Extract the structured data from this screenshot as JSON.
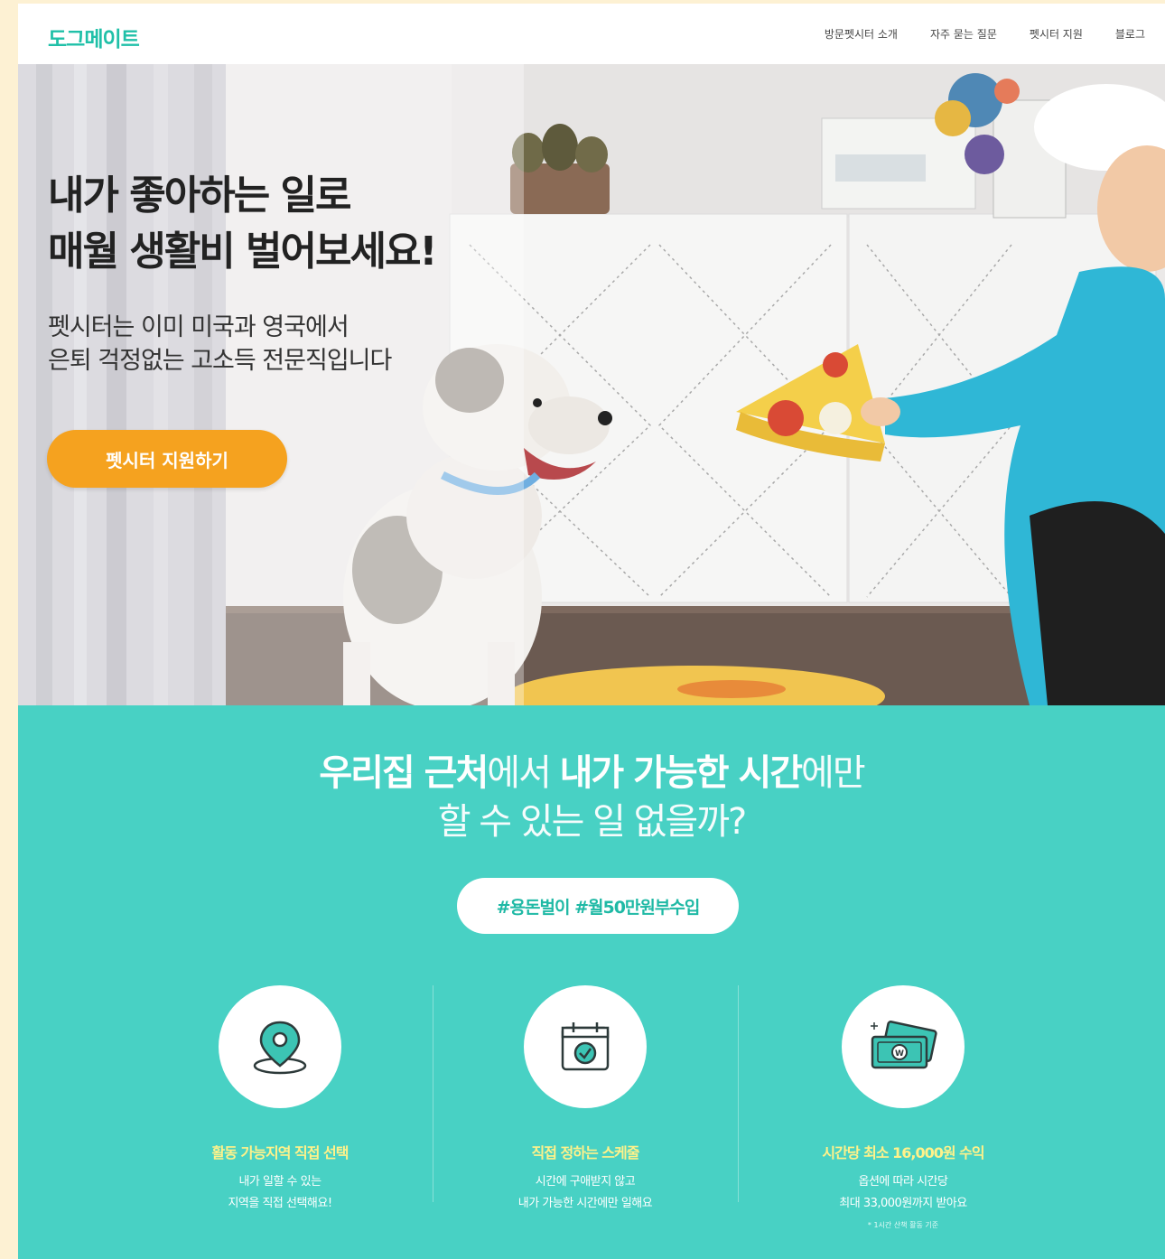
{
  "header": {
    "logo": "도그메이트",
    "nav": [
      "방문펫시터 소개",
      "자주 묻는 질문",
      "펫시터 지원",
      "블로그"
    ]
  },
  "hero": {
    "title_line1": "내가 좋아하는 일로",
    "title_line2": "매월 생활비 벌어보세요!",
    "sub_line1": "펫시터는 이미 미국과 영국에서",
    "sub_line2": "은퇴 걱정없는 고소득 전문직입니다",
    "cta": "펫시터 지원하기"
  },
  "section": {
    "line1_a": "우리집 근처",
    "line1_b": "에서 ",
    "line1_c": "내가 가능한 시간",
    "line1_d": "에만",
    "line2": "할 수 있는 일 없을까?",
    "tags": "#용돈벌이 #월50만원부수입"
  },
  "features": [
    {
      "icon": "location-pin-icon",
      "title": "활동 가능지역 직접 선택",
      "desc1": "내가 일할 수 있는",
      "desc2": "지역을 직접 선택해요!"
    },
    {
      "icon": "calendar-check-icon",
      "title": "직접 정하는 스케줄",
      "desc1": "시간에 구애받지 않고",
      "desc2": "내가 가능한 시간에만 일해요"
    },
    {
      "icon": "money-icon",
      "title": "시간당 최소 16,000원 수익",
      "desc1": "옵션에 따라 시간당",
      "desc2": "최대 33,000원까지 받아요",
      "note": "* 1시간 산책 활동 기준"
    }
  ],
  "colors": {
    "brand_teal": "#48d1c4",
    "logo_teal": "#20c0a8",
    "cta_orange": "#f5a21f",
    "feature_title_yellow": "#fff28a"
  }
}
